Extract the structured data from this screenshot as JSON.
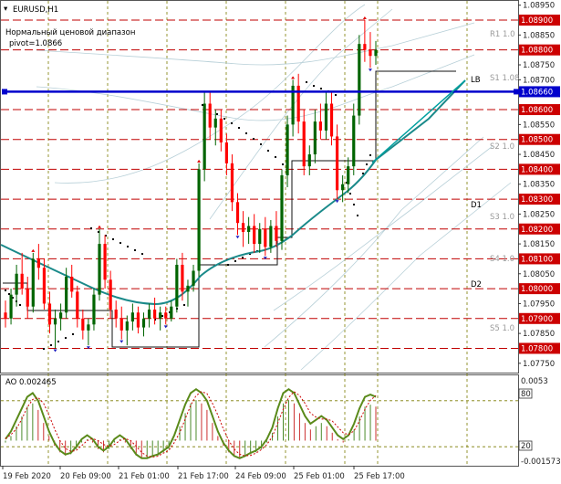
{
  "chart_header": {
    "symbol": "EURUSD,H1",
    "indicator_name": "Нормальный ценовой диапазон",
    "pivot_label": "pivot=1.0866"
  },
  "price_axis": {
    "ticks": [
      "1.08950",
      "1.08900",
      "1.08850",
      "1.08800",
      "1.08750",
      "1.08700",
      "1.08660",
      "1.08650",
      "1.08600",
      "1.08550",
      "1.08500",
      "1.08450",
      "1.08400",
      "1.08350",
      "1.08300",
      "1.08250",
      "1.08200",
      "1.08150",
      "1.08100",
      "1.08050",
      "1.08000",
      "1.07950",
      "1.07900",
      "1.07850",
      "1.07800",
      "1.07750"
    ],
    "highlight_levels": [
      "1.08900",
      "1.08800",
      "1.08600",
      "1.08500",
      "1.08400",
      "1.08300",
      "1.08200",
      "1.08100",
      "1.08000",
      "1.07900",
      "1.07800"
    ],
    "current_level": "1.08660"
  },
  "level_labels": {
    "r1": "R1 1.0",
    "s1": "S1 1.08",
    "s2": "S2 1.0",
    "s3": "S3 1.0",
    "s4": "S4 1.0",
    "s5": "S5 1.0",
    "lb": "LB",
    "d1": "D1",
    "d2": "D2"
  },
  "oscillator": {
    "title": "AO 0.002465",
    "axis_top": "0.0053",
    "axis_bottom": "-0.001573",
    "level_high": "80",
    "level_low": "20"
  },
  "time_axis": {
    "labels": [
      "19 Feb 2020",
      "20 Feb 09:00",
      "21 Feb 01:00",
      "21 Feb 17:00",
      "24 Feb 09:00",
      "25 Feb 01:00",
      "25 Feb 17:00"
    ]
  },
  "colors": {
    "candle_up": "#006400",
    "candle_down": "#ff0000",
    "level_line": "#c00000",
    "current_line": "#0000cc",
    "ma_line": "#1a8a8a",
    "trend_line": "#00a0a0",
    "osc_line": "#5a8a1a",
    "osc_line2": "#cc0000",
    "grid": "#7a7a00"
  },
  "chart_data": {
    "type": "candlestick",
    "title": "EURUSD,H1",
    "ylim": [
      1.0775,
      1.0895
    ],
    "y_levels": [
      1.089,
      1.088,
      1.086,
      1.085,
      1.084,
      1.083,
      1.082,
      1.081,
      1.08,
      1.079,
      1.078
    ],
    "current_price": 1.0866,
    "candles": [
      [
        1.0792,
        1.0796,
        1.0787,
        1.079
      ],
      [
        1.079,
        1.08,
        1.0788,
        1.0798
      ],
      [
        1.0798,
        1.0808,
        1.0794,
        1.0805
      ],
      [
        1.0805,
        1.0812,
        1.0798,
        1.08
      ],
      [
        1.08,
        1.0804,
        1.079,
        1.0794
      ],
      [
        1.0794,
        1.0812,
        1.0792,
        1.081
      ],
      [
        1.081,
        1.0815,
        1.0803,
        1.0807
      ],
      [
        1.0807,
        1.081,
        1.0793,
        1.0795
      ],
      [
        1.0795,
        1.0799,
        1.0785,
        1.0788
      ],
      [
        1.0788,
        1.0793,
        1.078,
        1.079
      ],
      [
        1.079,
        1.0795,
        1.0786,
        1.0792
      ],
      [
        1.0792,
        1.0807,
        1.079,
        1.0804
      ],
      [
        1.0804,
        1.0808,
        1.0797,
        1.0799
      ],
      [
        1.0799,
        1.0801,
        1.0787,
        1.079
      ],
      [
        1.079,
        1.0793,
        1.0783,
        1.0786
      ],
      [
        1.0786,
        1.079,
        1.0781,
        1.0788
      ],
      [
        1.0788,
        1.08,
        1.0786,
        1.0798
      ],
      [
        1.0798,
        1.082,
        1.0796,
        1.0815
      ],
      [
        1.0815,
        1.0818,
        1.08,
        1.0803
      ],
      [
        1.0803,
        1.0806,
        1.079,
        1.0793
      ],
      [
        1.0793,
        1.0796,
        1.0787,
        1.079
      ],
      [
        1.079,
        1.0794,
        1.0783,
        1.0786
      ],
      [
        1.0786,
        1.0791,
        1.0781,
        1.0789
      ],
      [
        1.0789,
        1.0795,
        1.0786,
        1.0792
      ],
      [
        1.0792,
        1.0794,
        1.0785,
        1.0787
      ],
      [
        1.0787,
        1.0792,
        1.0784,
        1.079
      ],
      [
        1.079,
        1.0795,
        1.0787,
        1.0793
      ],
      [
        1.0793,
        1.0797,
        1.0788,
        1.079
      ],
      [
        1.079,
        1.0794,
        1.0786,
        1.0792
      ],
      [
        1.0792,
        1.0794,
        1.0788,
        1.079
      ],
      [
        1.079,
        1.0796,
        1.0789,
        1.0794
      ],
      [
        1.0794,
        1.081,
        1.0792,
        1.0808
      ],
      [
        1.0808,
        1.0812,
        1.0796,
        1.0799
      ],
      [
        1.0799,
        1.0803,
        1.0794,
        1.0801
      ],
      [
        1.0801,
        1.0808,
        1.0799,
        1.0806
      ],
      [
        1.0806,
        1.0842,
        1.0804,
        1.084
      ],
      [
        1.084,
        1.0866,
        1.0836,
        1.0862
      ],
      [
        1.0862,
        1.0866,
        1.085,
        1.0854
      ],
      [
        1.0854,
        1.086,
        1.0848,
        1.0857
      ],
      [
        1.0857,
        1.086,
        1.0846,
        1.0849
      ],
      [
        1.0849,
        1.0852,
        1.0838,
        1.0842
      ],
      [
        1.0842,
        1.0845,
        1.0826,
        1.0829
      ],
      [
        1.0829,
        1.0832,
        1.0818,
        1.0822
      ],
      [
        1.0822,
        1.0826,
        1.0814,
        1.0819
      ],
      [
        1.0819,
        1.0824,
        1.0815,
        1.0821
      ],
      [
        1.0821,
        1.0825,
        1.0812,
        1.0815
      ],
      [
        1.0815,
        1.0822,
        1.0812,
        1.082
      ],
      [
        1.082,
        1.0824,
        1.0811,
        1.0814
      ],
      [
        1.0814,
        1.0823,
        1.0812,
        1.0821
      ],
      [
        1.0821,
        1.0826,
        1.0814,
        1.0816
      ],
      [
        1.0816,
        1.084,
        1.0813,
        1.0838
      ],
      [
        1.0838,
        1.0858,
        1.0834,
        1.0855
      ],
      [
        1.0855,
        1.087,
        1.0851,
        1.0868
      ],
      [
        1.0868,
        1.0872,
        1.0852,
        1.0856
      ],
      [
        1.0856,
        1.086,
        1.0838,
        1.0841
      ],
      [
        1.0841,
        1.0848,
        1.0838,
        1.0845
      ],
      [
        1.0845,
        1.086,
        1.0842,
        1.0856
      ],
      [
        1.0856,
        1.0862,
        1.085,
        1.0853
      ],
      [
        1.0853,
        1.0866,
        1.085,
        1.0862
      ],
      [
        1.0862,
        1.0866,
        1.0848,
        1.0851
      ],
      [
        1.0851,
        1.0855,
        1.083,
        1.0833
      ],
      [
        1.0833,
        1.0838,
        1.0829,
        1.0835
      ],
      [
        1.0835,
        1.0844,
        1.0832,
        1.0841
      ],
      [
        1.0841,
        1.0862,
        1.0838,
        1.0858
      ],
      [
        1.0858,
        1.0885,
        1.0855,
        1.0882
      ],
      [
        1.0882,
        1.089,
        1.0876,
        1.088
      ],
      [
        1.088,
        1.0886,
        1.0874,
        1.0878
      ],
      [
        1.0878,
        1.0883,
        1.0875,
        1.088
      ]
    ],
    "ao_values": [
      0.3,
      0.4,
      0.55,
      0.7,
      0.85,
      0.9,
      0.8,
      0.6,
      0.4,
      0.25,
      0.15,
      0.1,
      0.12,
      0.2,
      0.3,
      0.35,
      0.3,
      0.2,
      0.15,
      0.2,
      0.3,
      0.35,
      0.3,
      0.2,
      0.1,
      0.05,
      0.05,
      0.08,
      0.1,
      0.15,
      0.2,
      0.35,
      0.55,
      0.75,
      0.9,
      0.95,
      0.9,
      0.8,
      0.6,
      0.4,
      0.25,
      0.15,
      0.08,
      0.05,
      0.08,
      0.12,
      0.15,
      0.2,
      0.3,
      0.45,
      0.7,
      0.9,
      0.95,
      0.9,
      0.75,
      0.6,
      0.5,
      0.55,
      0.6,
      0.55,
      0.45,
      0.35,
      0.3,
      0.35,
      0.5,
      0.7,
      0.85,
      0.88,
      0.85
    ]
  }
}
